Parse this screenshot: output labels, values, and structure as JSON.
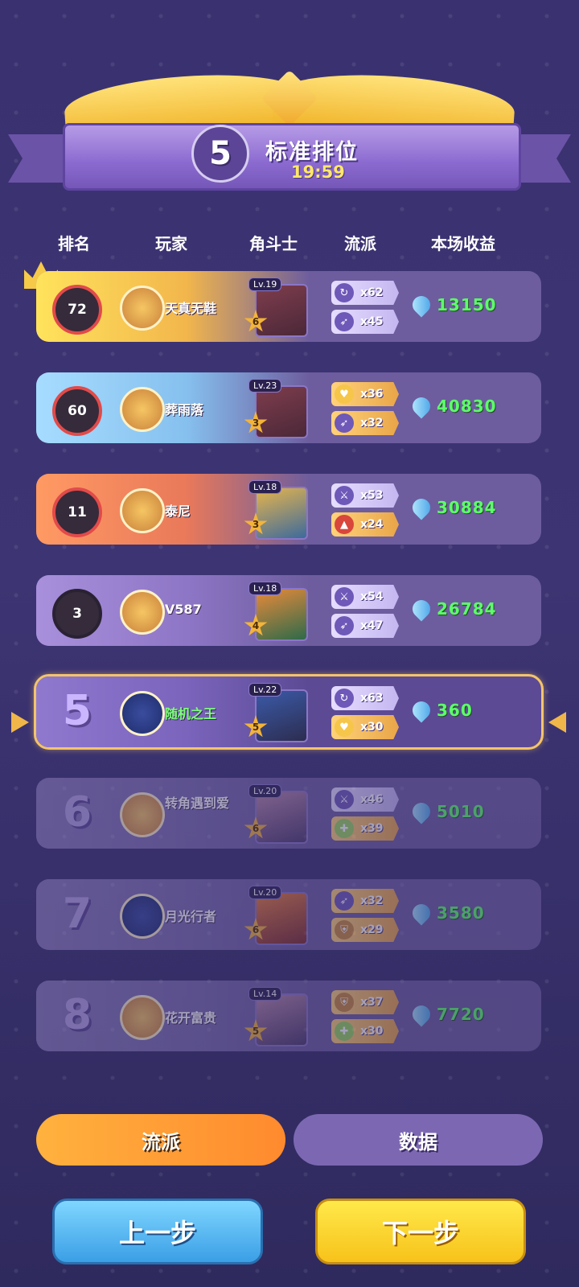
{
  "header": {
    "rank": "5",
    "title": "标准排位",
    "timer": "19:59"
  },
  "columns": {
    "rank": "排名",
    "player": "玩家",
    "hero": "角斗士",
    "school": "流派",
    "income": "本场收益"
  },
  "rows": [
    {
      "rank_value": "72",
      "name": "天真无鞋",
      "hero_level": "Lv.19",
      "hero_star": "6",
      "tags": [
        {
          "icon": "swirl-icon",
          "count": "x62"
        },
        {
          "icon": "boot-icon",
          "count": "x45"
        }
      ],
      "income": "13150"
    },
    {
      "rank_value": "60",
      "name": "葬雨落",
      "hero_level": "Lv.23",
      "hero_star": "3",
      "tags": [
        {
          "icon": "heart-icon",
          "count": "x36"
        },
        {
          "icon": "boot-icon",
          "count": "x32"
        }
      ],
      "income": "40830"
    },
    {
      "rank_value": "11",
      "name": "泰尼",
      "hero_level": "Lv.18",
      "hero_star": "3",
      "tags": [
        {
          "icon": "sword-icon",
          "count": "x53"
        },
        {
          "icon": "fire-icon",
          "count": "x24"
        }
      ],
      "income": "30884"
    },
    {
      "rank_value": "3",
      "name": "V587",
      "hero_level": "Lv.18",
      "hero_star": "4",
      "tags": [
        {
          "icon": "sword-icon",
          "count": "x54"
        },
        {
          "icon": "boot-icon",
          "count": "x47"
        }
      ],
      "income": "26784"
    },
    {
      "rank_value": "5",
      "name": "随机之王",
      "hero_level": "Lv.22",
      "hero_star": "5",
      "tags": [
        {
          "icon": "swirl-icon",
          "count": "x63"
        },
        {
          "icon": "heart-icon",
          "count": "x30"
        }
      ],
      "income": "360"
    },
    {
      "rank_value": "6",
      "name": "转角遇到爱",
      "hero_level": "Lv.20",
      "hero_star": "6",
      "tags": [
        {
          "icon": "sword-icon",
          "count": "x46"
        },
        {
          "icon": "cross-icon",
          "count": "x39"
        }
      ],
      "income": "5010"
    },
    {
      "rank_value": "7",
      "name": "月光行者",
      "hero_level": "Lv.20",
      "hero_star": "6",
      "tags": [
        {
          "icon": "boot-icon",
          "count": "x32"
        },
        {
          "icon": "shield-icon",
          "count": "x29"
        }
      ],
      "income": "3580"
    },
    {
      "rank_value": "8",
      "name": "花开富贵",
      "hero_level": "Lv.14",
      "hero_star": "5",
      "tags": [
        {
          "icon": "shield-icon",
          "count": "x37"
        },
        {
          "icon": "cross-icon",
          "count": "x30"
        }
      ],
      "income": "7720"
    }
  ],
  "tabs": {
    "school": "流派",
    "data": "数据"
  },
  "buttons": {
    "prev": "上一步",
    "next": "下一步"
  }
}
